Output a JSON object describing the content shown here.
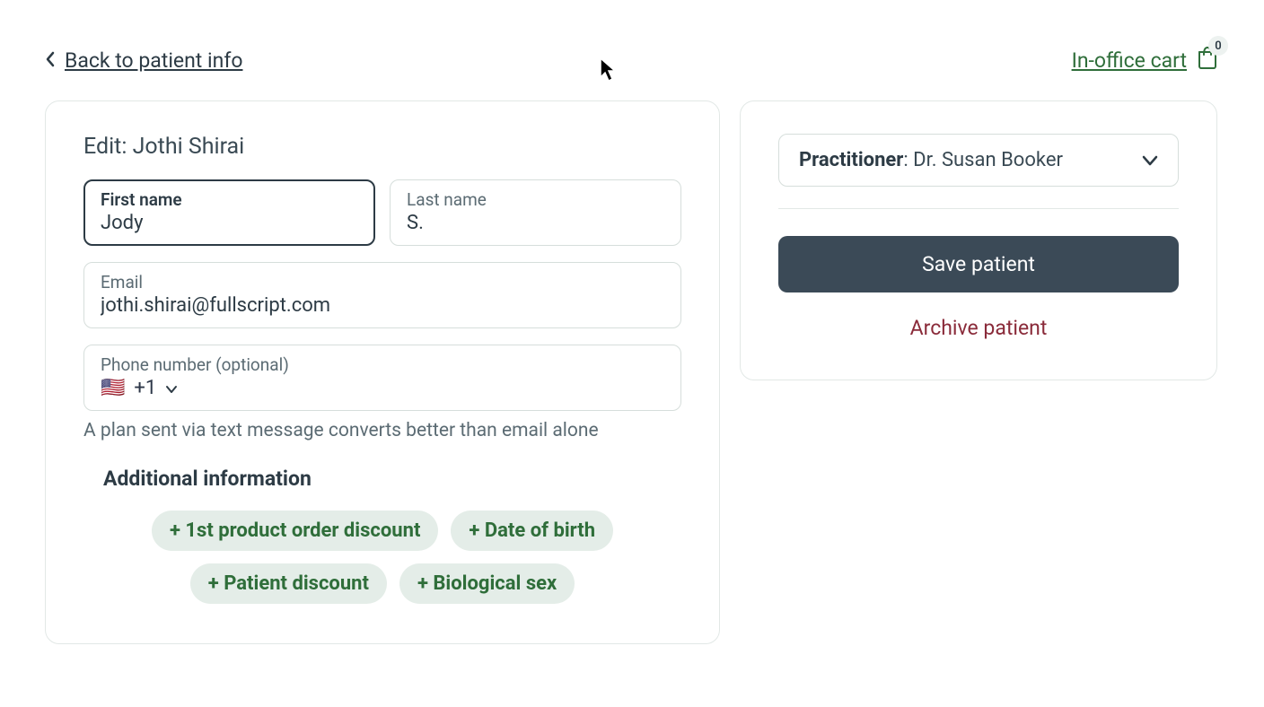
{
  "top": {
    "back_label": "Back to patient info",
    "cart_label": "In-office cart",
    "cart_count": "0"
  },
  "form": {
    "edit_title": "Edit: Jothi Shirai",
    "first_name_label": "First name",
    "first_name_value": "Jody",
    "last_name_label": "Last name",
    "last_name_value": "S.",
    "email_label": "Email",
    "email_value": "jothi.shirai@fullscript.com",
    "phone_label": "Phone number (optional)",
    "phone_flag": "🇺🇸",
    "phone_code": "+1",
    "phone_hint": "A plan sent via text message converts better than email alone",
    "additional_heading": "Additional information",
    "chips": {
      "product_discount": "+ 1st product order discount",
      "dob": "+ Date of birth",
      "patient_discount": "+ Patient discount",
      "bio_sex": "+ Biological sex"
    }
  },
  "sidebar": {
    "practitioner_label": "Practitioner",
    "practitioner_name": ": Dr. Susan Booker",
    "save_label": "Save patient",
    "archive_label": "Archive patient"
  }
}
